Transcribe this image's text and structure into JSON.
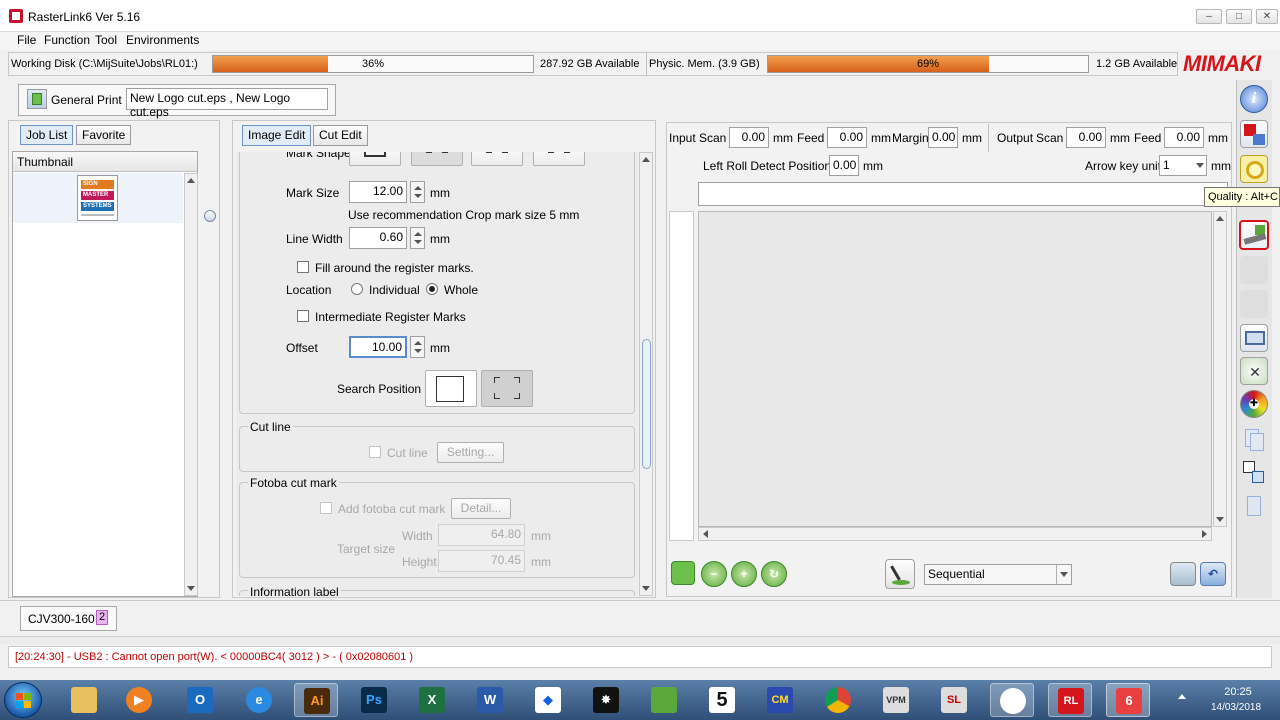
{
  "window": {
    "title": "RasterLink6 Ver 5.16"
  },
  "menu": [
    "File",
    "Function",
    "Tool",
    "Environments"
  ],
  "status": {
    "working_disk_label": "Working Disk (C:\\MijSuite\\Jobs\\RL01:)",
    "working_disk_pct": "36%",
    "working_disk_fraction": 0.36,
    "working_disk_available": "287.92 GB Available",
    "physic_mem_label": "Physic. Mem. (3.9 GB)",
    "physic_mem_pct": "69%",
    "physic_mem_fraction": 0.69,
    "physic_mem_available": "1.2 GB Available",
    "brand": "MIMAKI"
  },
  "print_header": {
    "label": "General Print",
    "files": "New Logo cut.eps , New Logo cut.eps"
  },
  "left_tabs": [
    "Job List",
    "Favorite"
  ],
  "thumbnail": {
    "header": "Thumbnail",
    "logo_lines": [
      "SIGN",
      "MASTER",
      "SYSTEMS"
    ]
  },
  "edit_tabs": [
    "Image Edit",
    "Cut Edit"
  ],
  "image_edit": {
    "mark_shape_label": "Mark Shape",
    "mark_size_label": "Mark Size",
    "mark_size_value": "12.00",
    "unit": "mm",
    "recommendation": "Use recommendation Crop mark size 5 mm",
    "line_width_label": "Line Width",
    "line_width_value": "0.60",
    "fill_register": "Fill around the register marks.",
    "location_label": "Location",
    "location_individual": "Individual",
    "location_whole": "Whole",
    "intermediate": "Intermediate Register Marks",
    "offset_label": "Offset",
    "offset_value": "10.00",
    "search_position_label": "Search Position",
    "cut_line_group": "Cut line",
    "cut_line_check": "Cut line",
    "setting_button": "Setting...",
    "fotoba_group": "Fotoba cut mark",
    "fotoba_check": "Add fotoba cut mark",
    "detail_button": "Detail...",
    "target_size_label": "Target size",
    "width_label": "Width",
    "width_value": "64.80",
    "height_label": "Height",
    "height_value": "70.45",
    "info_group": "Information label"
  },
  "scan": {
    "input_label": "Input",
    "scan_label": "Scan",
    "input_scan": "0.00",
    "feed_label": "Feed",
    "input_feed": "0.00",
    "margin_label": "Margin",
    "margin_value": "0.00",
    "output_label": "Output",
    "output_scan": "0.00",
    "output_feed": "0.00",
    "mm": "mm",
    "left_roll_label": "Left Roll Detect Position",
    "left_roll_value": "0.00",
    "arrow_key_label": "Arrow key unit",
    "arrow_key_value": "1"
  },
  "tooltip": "Quality : Alt+C",
  "preview": {
    "sequence_value": "Sequential"
  },
  "printer": {
    "name": "CJV300-160",
    "number": "2"
  },
  "log": {
    "message": "[20:24:30] - USB2 : Cannot open port(W).  < 00000BC4( 3012 ) > - ( 0x02080601 )"
  },
  "clock": {
    "time": "20:25",
    "date": "14/03/2018"
  },
  "taskbar_icons": [
    "start-orb",
    "explorer-icon",
    "media-player-icon",
    "outlook-icon",
    "ie-icon",
    "illustrator-icon",
    "photoshop-icon",
    "excel-icon",
    "word-icon",
    "dropbox-icon",
    "corel-icon",
    "coreldraw-icon",
    "app5-icon",
    "cpm-icon",
    "chrome-icon",
    "vpm-icon",
    "sl-icon",
    "media-icon",
    "rl6-icon",
    "rasterlink-icon"
  ]
}
